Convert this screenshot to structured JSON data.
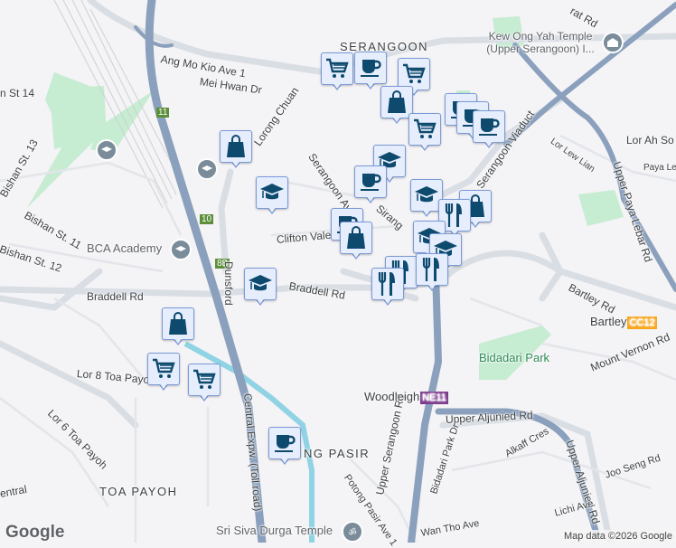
{
  "map": {
    "areas": {
      "serangoon": "SERANGOON",
      "toa_payoh": "TOA PAYOH",
      "potong_pasir": "NG PASIR"
    },
    "roads": {
      "amk1": "Ang Mo Kio Ave 1",
      "mei_hwan": "Mei Hwan Dr",
      "lorong_chuan": "Lorong Chuan",
      "bishan14": "n St 14",
      "bishan13": "Bishan St. 13",
      "bishan11": "Bishan St. 11",
      "bishan12": "Bishan St. 12",
      "serangoon_av": "Serangoon Av",
      "sirang": "Sirang",
      "clifton": "Clifton Vale",
      "dunsford": "Dunsford",
      "braddell1": "Braddell Rd",
      "braddell2": "Braddell Rd",
      "lor8": "Lor 8 Toa Payoh",
      "lor6": "Lor 6 Toa Payoh",
      "central": "entral",
      "cte": "Central Expw. (Toll road)",
      "viaduct": "Serangoon Viaduct",
      "lor_lew_lian": "Lor Lew Lian",
      "lor_ah_soo": "Lor Ah So",
      "paya_le": "Paya Le",
      "upl": "Upper Paya Lebar Rd",
      "bartley_rd": "Bartley Rd",
      "mount_vernon": "Mount Vernon Rd",
      "upper_aljunied1": "Upper Aljunied Rd",
      "upper_aljunied2": "Upper Aljunied Rd",
      "alkaff": "Alkaff Cres",
      "joo_seng": "Joo Seng Rd",
      "bidadari_park_dr": "Bidadari Park Dr",
      "upper_serangoon": "Upper Serangoon Rd",
      "potong_ave1": "Potong Pasir Ave 1",
      "wan_tho": "Wan Tho Ave",
      "lichi": "Lichi Ave",
      "rat_rd": "rat Rd"
    },
    "pois": {
      "kew_ong_yah": "Kew Ong Yah Temple (Upper Serangoon) I...",
      "bca": "BCA Academy",
      "sri_siva": "Sri Siva Durga Temple",
      "bidadari": "Bidadari Park"
    },
    "stations": [
      {
        "name": "Bartley",
        "code": "CC12",
        "color": "#f9a61a"
      },
      {
        "name": "Woodleigh",
        "code": "NE11",
        "color": "#7b3a8c"
      }
    ],
    "shields": [
      "11",
      "10",
      "8B"
    ],
    "markers": [
      {
        "icon": "cart-icon"
      },
      {
        "icon": "cup-icon"
      },
      {
        "icon": "cart-icon"
      },
      {
        "icon": "bag-icon"
      },
      {
        "icon": "cart-icon"
      },
      {
        "icon": "cup-icon"
      },
      {
        "icon": "cup-icon"
      },
      {
        "icon": "cup-icon"
      },
      {
        "icon": "bag-icon"
      },
      {
        "icon": "graduation-cap-icon"
      },
      {
        "icon": "graduation-cap-icon"
      },
      {
        "icon": "cup-icon"
      },
      {
        "icon": "cup-icon"
      },
      {
        "icon": "bag-icon"
      },
      {
        "icon": "graduation-cap-icon"
      },
      {
        "icon": "bag-icon"
      },
      {
        "icon": "fork-knife-icon"
      },
      {
        "icon": "graduation-cap-icon"
      },
      {
        "icon": "graduation-cap-icon"
      },
      {
        "icon": "fork-knife-icon"
      },
      {
        "icon": "fork-knife-icon"
      },
      {
        "icon": "fork-knife-icon"
      },
      {
        "icon": "graduation-cap-icon"
      },
      {
        "icon": "bag-icon"
      },
      {
        "icon": "cart-icon"
      },
      {
        "icon": "cart-icon"
      },
      {
        "icon": "cup-icon"
      }
    ],
    "colors": {
      "background": "#f4f3f5",
      "highway": "#8aa0bd",
      "road": "#d9dee5",
      "park": "#c6ecd2",
      "river": "#8fd3e4",
      "marker_fill": "#e6edfc",
      "marker_border": "#7a9ad8",
      "icon": "#0d4a6e"
    },
    "logo": "Google",
    "attribution": "Map data ©2026 Google"
  }
}
